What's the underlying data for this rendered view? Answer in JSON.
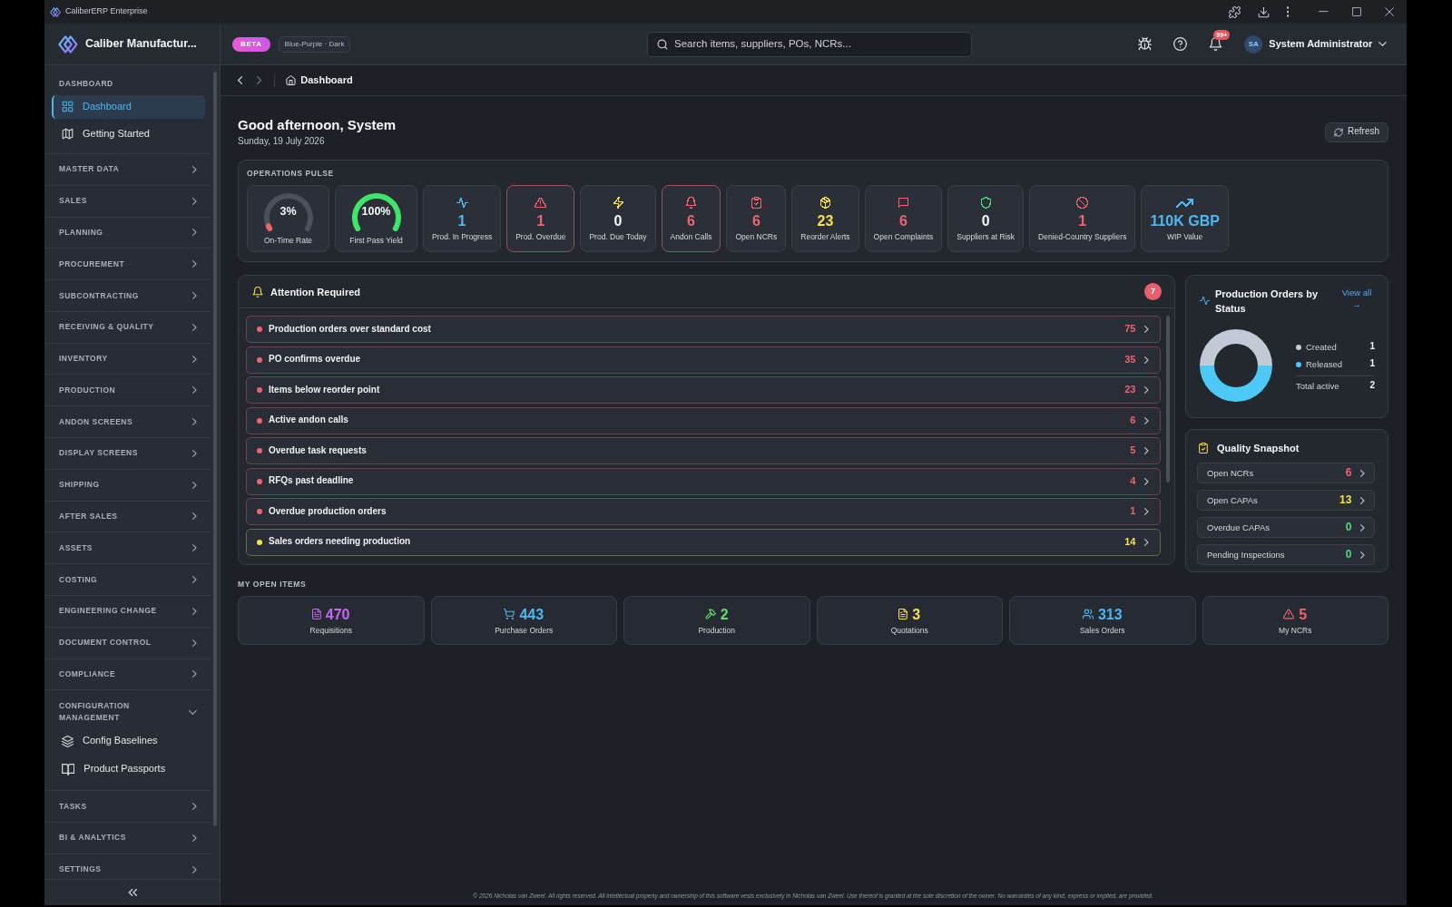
{
  "window": {
    "title": "CaliberERP Enterprise"
  },
  "header": {
    "brand": "Caliber Manufactur...",
    "badge": "BETA",
    "theme": "Blue-Purple · Dark",
    "search": {
      "placeholder": "Search items, suppliers, POs, NCRs..."
    },
    "notifications": "99+",
    "user": {
      "initials": "SA",
      "name": "System Administrator"
    }
  },
  "sidebar": {
    "groups": [
      {
        "label": "DASHBOARD",
        "kind": "heading",
        "expanded": true,
        "items": [
          {
            "label": "Dashboard",
            "selected": true
          },
          {
            "label": "Getting Started",
            "selected": false
          }
        ]
      },
      {
        "label": "MASTER DATA",
        "kind": "collapsible",
        "expanded": false
      },
      {
        "label": "SALES",
        "kind": "collapsible",
        "expanded": false
      },
      {
        "label": "PLANNING",
        "kind": "collapsible",
        "expanded": false
      },
      {
        "label": "PROCUREMENT",
        "kind": "collapsible",
        "expanded": false
      },
      {
        "label": "SUBCONTRACTING",
        "kind": "collapsible",
        "expanded": false
      },
      {
        "label": "RECEIVING & QUALITY",
        "kind": "collapsible",
        "expanded": false
      },
      {
        "label": "INVENTORY",
        "kind": "collapsible",
        "expanded": false
      },
      {
        "label": "PRODUCTION",
        "kind": "collapsible",
        "expanded": false
      },
      {
        "label": "ANDON SCREENS",
        "kind": "collapsible",
        "expanded": false
      },
      {
        "label": "DISPLAY SCREENS",
        "kind": "collapsible",
        "expanded": false
      },
      {
        "label": "SHIPPING",
        "kind": "collapsible",
        "expanded": false
      },
      {
        "label": "AFTER SALES",
        "kind": "collapsible",
        "expanded": false
      },
      {
        "label": "ASSETS",
        "kind": "collapsible",
        "expanded": false
      },
      {
        "label": "COSTING",
        "kind": "collapsible",
        "expanded": false
      },
      {
        "label": "ENGINEERING CHANGE",
        "kind": "collapsible",
        "expanded": false
      },
      {
        "label": "DOCUMENT CONTROL",
        "kind": "collapsible",
        "expanded": false
      },
      {
        "label": "COMPLIANCE",
        "kind": "collapsible",
        "expanded": false
      },
      {
        "label": "CONFIGURATION MANAGEMENT",
        "kind": "collapsible",
        "expanded": true,
        "items": [
          {
            "label": "Config Baselines",
            "selected": false
          },
          {
            "label": "Product Passports",
            "selected": false
          }
        ]
      },
      {
        "label": "TASKS",
        "kind": "collapsible",
        "expanded": false
      },
      {
        "label": "BI & ANALYTICS",
        "kind": "collapsible",
        "expanded": false
      },
      {
        "label": "SETTINGS",
        "kind": "collapsible",
        "expanded": false
      }
    ]
  },
  "breadcrumb": {
    "history": [
      {
        "kind": "back",
        "disabled": false
      },
      {
        "kind": "forward",
        "disabled": true
      }
    ],
    "current": "Dashboard"
  },
  "greeting": {
    "title": "Good afternoon, System",
    "date": "Sunday, 19 July 2026"
  },
  "refresh_button": "Refresh",
  "operations_pulse": {
    "title": "OPERATIONS PULSE",
    "tiles": [
      {
        "kind": "gauge",
        "value": "3%",
        "label": "On-Time Rate",
        "level": 0.03,
        "color": "#f0636f"
      },
      {
        "kind": "gauge",
        "value": "100%",
        "label": "First Pass Yield",
        "level": 1,
        "color": "#3fe46b"
      },
      {
        "kind": "stat",
        "value": "1",
        "label": "Prod. In Progress",
        "color": "#4db8f2",
        "tinted": true,
        "alert": false
      },
      {
        "kind": "stat",
        "value": "1",
        "label": "Prod. Overdue",
        "color": "#f0636f",
        "tinted": true,
        "alert": true
      },
      {
        "kind": "stat",
        "value": "0",
        "label": "Prod. Due Today",
        "color": "#f5e14b",
        "tinted": false,
        "alert": false
      },
      {
        "kind": "stat",
        "value": "6",
        "label": "Andon Calls",
        "color": "#f0636f",
        "tinted": true,
        "alert": true
      },
      {
        "kind": "stat",
        "value": "6",
        "label": "Open NCRs",
        "color": "#f0636f",
        "tinted": true,
        "alert": false
      },
      {
        "kind": "stat",
        "value": "23",
        "label": "Reorder Alerts",
        "color": "#f5e14b",
        "tinted": true,
        "alert": false
      },
      {
        "kind": "stat",
        "value": "6",
        "label": "Open Complaints",
        "color": "#f0636f",
        "tinted": true,
        "alert": false
      },
      {
        "kind": "stat",
        "value": "0",
        "label": "Suppliers at Risk",
        "color": "#4cd97a",
        "tinted": false,
        "alert": false
      },
      {
        "kind": "stat",
        "value": "1",
        "label": "Denied-Country Suppliers",
        "color": "#f0636f",
        "tinted": true,
        "alert": false
      },
      {
        "kind": "stat",
        "value": "110K GBP",
        "label": "WIP Value",
        "color": "#4db8f2",
        "tinted": true,
        "alert": false
      }
    ]
  },
  "attention": {
    "title": "Attention Required",
    "count": "7",
    "items": [
      {
        "label": "Production orders over standard cost",
        "count": "75",
        "color": "#f0636f"
      },
      {
        "label": "PO confirms overdue",
        "count": "35",
        "color": "#f0636f"
      },
      {
        "label": "Items below reorder point",
        "count": "23",
        "color": "#f0636f"
      },
      {
        "label": "Active andon calls",
        "count": "6",
        "color": "#f0636f"
      },
      {
        "label": "Overdue task requests",
        "count": "5",
        "color": "#f0636f"
      },
      {
        "label": "RFQs past deadline",
        "count": "4",
        "color": "#f0636f"
      },
      {
        "label": "Overdue production orders",
        "count": "1",
        "color": "#f0636f"
      },
      {
        "label": "Sales orders needing production",
        "count": "14",
        "color": "#f5e14b"
      }
    ]
  },
  "production_orders": {
    "title": "Production Orders by Status",
    "link": "View all →",
    "chart_data": {
      "type": "donut",
      "categories": [
        "Created",
        "Released"
      ],
      "values": [
        50,
        50
      ]
    },
    "legend": [
      {
        "count": "1",
        "color": "#c3cad5"
      },
      {
        "count": "1",
        "color": "#4dc9f5"
      }
    ],
    "total": {
      "label": "Total active",
      "count": "2"
    }
  },
  "quality_snapshot": {
    "title": "Quality Snapshot",
    "items": [
      {
        "label": "Open NCRs",
        "count": "6",
        "color": "#f0636f"
      },
      {
        "label": "Open CAPAs",
        "count": "13",
        "color": "#f5e14b"
      },
      {
        "label": "Overdue CAPAs",
        "count": "0",
        "color": "#4ade80"
      },
      {
        "label": "Pending Inspections",
        "count": "0",
        "color": "#4ade80"
      }
    ]
  },
  "my_open_items": {
    "title": "MY OPEN ITEMS",
    "tiles": [
      {
        "value": "470",
        "label": "Requisitions",
        "color": "#c768f5"
      },
      {
        "value": "443",
        "label": "Purchase Orders",
        "color": "#4db8f2"
      },
      {
        "value": "2",
        "label": "Production",
        "color": "#62dd6a"
      },
      {
        "value": "3",
        "label": "Quotations",
        "color": "#f5e14b"
      },
      {
        "value": "313",
        "label": "Sales Orders",
        "color": "#4db8f2"
      },
      {
        "value": "5",
        "label": "My NCRs",
        "color": "#f0636f"
      }
    ]
  },
  "footer": "© 2026 Nicholas van Zweel. All rights reserved. All intellectual property and ownership of this software vests exclusively in Nicholas van Zweel. Use thereof is granted at the sole discretion of the owner. No warranties of any kind, express or implied, are provided."
}
